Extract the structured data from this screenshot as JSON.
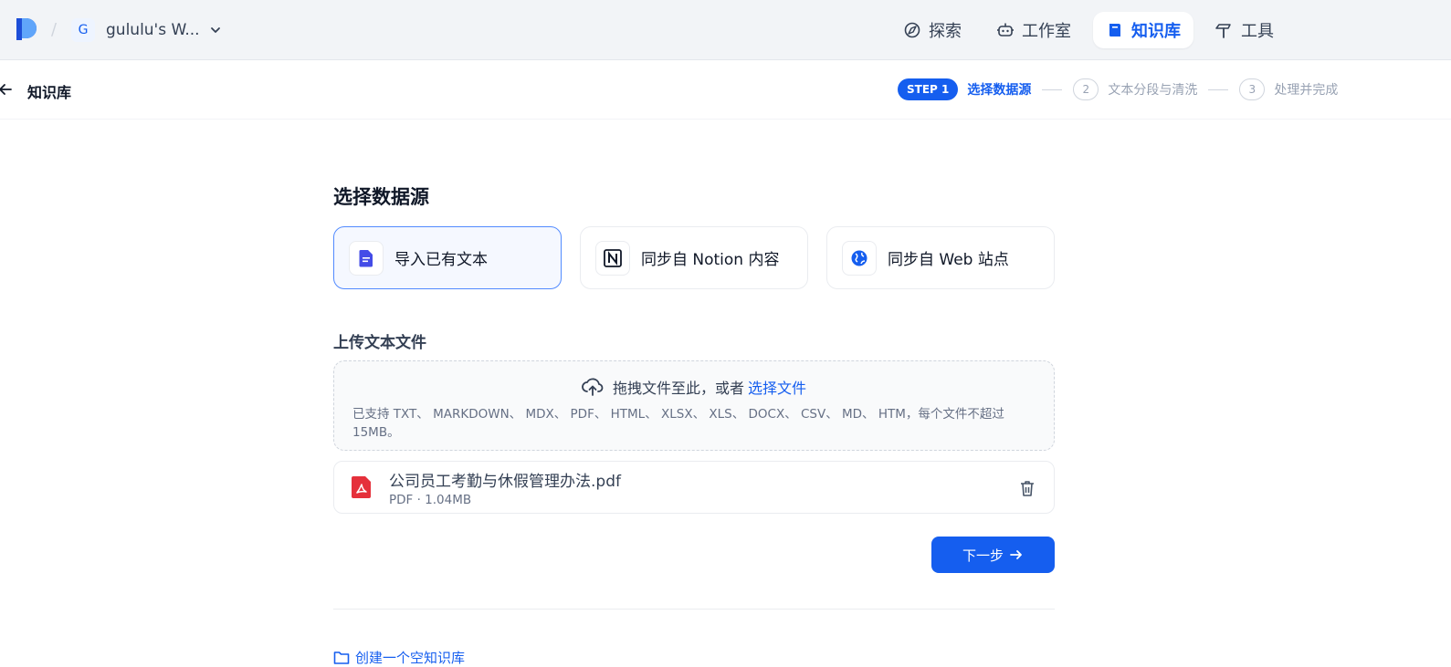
{
  "topbar": {
    "workspace_initial": "G",
    "workspace_name": "gululu's W...",
    "nav": [
      {
        "label": "探索",
        "icon": "compass-icon"
      },
      {
        "label": "工作室",
        "icon": "robot-icon"
      },
      {
        "label": "知识库",
        "icon": "book-icon",
        "active": true
      },
      {
        "label": "工具",
        "icon": "hammer-icon"
      }
    ]
  },
  "subheader": {
    "title": "知识库",
    "steps": [
      {
        "pill": "STEP 1",
        "label": "选择数据源",
        "active": true
      },
      {
        "number": "2",
        "label": "文本分段与清洗"
      },
      {
        "number": "3",
        "label": "处理并完成"
      }
    ]
  },
  "main": {
    "title": "选择数据源",
    "sources": [
      {
        "label": "导入已有文本",
        "icon": "document-icon",
        "selected": true
      },
      {
        "label": "同步自 Notion 内容",
        "icon": "notion-icon"
      },
      {
        "label": "同步自 Web 站点",
        "icon": "globe-icon"
      }
    ],
    "upload": {
      "title": "上传文本文件",
      "drag_text": "拖拽文件至此，或者",
      "choose_link": "选择文件",
      "supported": "已支持 TXT、 MARKDOWN、 MDX、 PDF、 HTML、 XLSX、 XLS、 DOCX、 CSV、 MD、 HTM，每个文件不超过 15MB。"
    },
    "file": {
      "name": "公司员工考勤与休假管理办法.pdf",
      "meta": "PDF · 1.04MB"
    },
    "next_button": "下一步",
    "empty_kb_link": "创建一个空知识库"
  },
  "colors": {
    "accent": "#155eef",
    "topbar_bg": "#f2f4f7",
    "pdf_red": "#e5303b"
  }
}
